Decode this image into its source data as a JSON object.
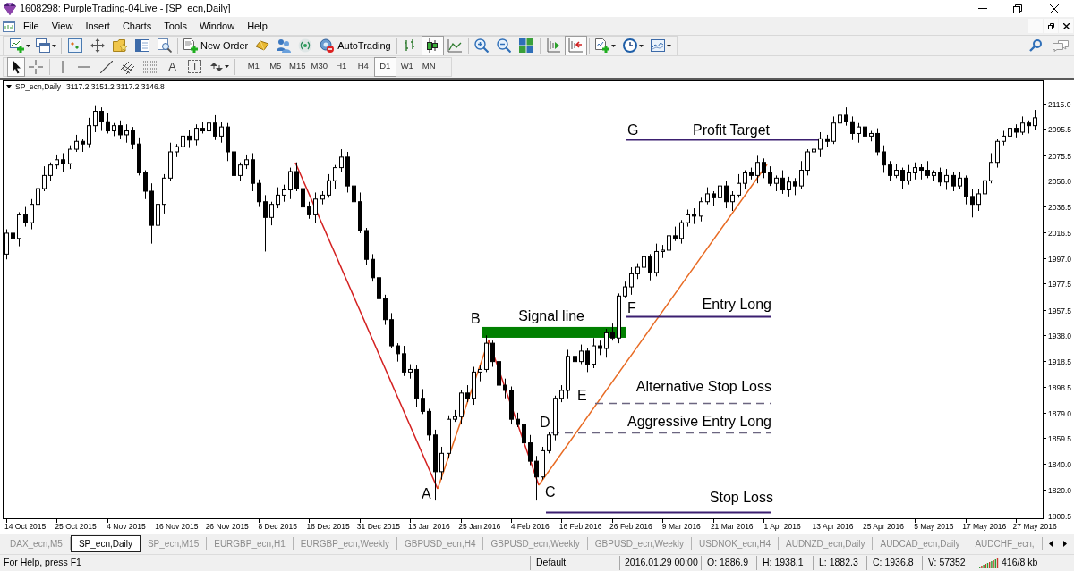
{
  "window": {
    "title": "1608298: PurpleTrading-04Live - [SP_ecn,Daily]"
  },
  "menu": [
    "File",
    "View",
    "Insert",
    "Charts",
    "Tools",
    "Window",
    "Help"
  ],
  "toolbar": {
    "new_order": "New Order",
    "auto_trading": "AutoTrading",
    "chart_types": [
      {
        "kind": "bar",
        "selected": false
      },
      {
        "kind": "candle",
        "selected": true
      },
      {
        "kind": "line",
        "selected": false
      }
    ],
    "toggles": [
      {
        "kind": "chart_shift",
        "on": false
      },
      {
        "kind": "autoscroll",
        "on": true
      }
    ]
  },
  "drawing_toolbar": {
    "tools": [
      {
        "kind": "cursor",
        "selected": true
      },
      {
        "kind": "crosshair",
        "selected": false
      },
      {
        "kind": "vertical_line",
        "selected": false
      },
      {
        "kind": "horizontal_line",
        "selected": false
      },
      {
        "kind": "trendline",
        "selected": false
      },
      {
        "kind": "channel",
        "selected": false
      },
      {
        "kind": "fibonacci",
        "selected": false
      },
      {
        "kind": "text",
        "label": "A",
        "selected": false
      },
      {
        "kind": "text_label",
        "label": "T",
        "selected": false
      },
      {
        "kind": "arrows",
        "selected": false
      }
    ],
    "timeframes": [
      {
        "label": "M1",
        "selected": false
      },
      {
        "label": "M5",
        "selected": false
      },
      {
        "label": "M15",
        "selected": false
      },
      {
        "label": "M30",
        "selected": false
      },
      {
        "label": "H1",
        "selected": false
      },
      {
        "label": "H4",
        "selected": false
      },
      {
        "label": "D1",
        "selected": true
      },
      {
        "label": "W1",
        "selected": false
      },
      {
        "label": "MN",
        "selected": false
      }
    ]
  },
  "chart": {
    "symbol": "SP_ecn,Daily",
    "quote": "3117.2 3151.2 3117.2 3146.8",
    "chart_data": {
      "type": "candlestick",
      "categories": [
        null,
        null,
        null,
        "14 Oct 2015",
        null,
        null,
        null,
        null,
        null,
        null,
        null,
        "25 Oct 2015",
        null,
        null,
        null,
        null,
        null,
        null,
        null,
        "4 Nov 2015",
        null,
        null,
        null,
        null,
        null,
        null,
        null,
        "16 Nov 2015",
        null,
        null,
        null,
        null,
        null,
        null,
        null,
        "26 Nov 2015",
        null,
        null,
        null,
        null,
        null,
        null,
        null,
        "8 Dec 2015",
        null,
        null,
        null,
        null,
        null,
        null,
        null,
        "18 Dec 2015",
        null,
        null,
        null,
        null,
        null,
        null,
        null,
        "31 Dec 2015",
        null,
        null,
        null,
        null,
        null,
        null,
        null,
        "13 Jan 2016",
        null,
        null,
        null,
        null,
        null,
        null,
        null,
        "25 Jan 2016",
        null,
        null,
        null,
        null,
        null,
        null,
        null,
        "4 Feb 2016",
        null,
        null,
        null,
        null,
        null,
        null,
        null,
        "16 Feb 2016",
        null,
        null,
        null,
        null,
        null,
        null,
        null,
        "26 Feb 2016",
        null,
        null,
        null,
        null,
        null,
        null,
        null,
        "9 Mar 2016",
        null,
        null,
        null,
        null,
        null,
        null,
        null,
        "21 Mar 2016",
        null,
        null,
        null,
        null,
        null,
        null,
        null,
        "1 Apr 2016",
        null,
        null,
        null,
        null,
        null,
        null,
        null,
        "13 Apr 2016",
        null,
        null,
        null,
        null,
        null,
        null,
        null,
        "25 Apr 2016",
        null,
        null,
        null,
        null,
        null,
        null,
        null,
        "5 May 2016",
        null,
        null,
        null,
        null,
        null,
        null,
        null,
        "17 May 2016",
        null,
        null,
        null,
        null,
        null,
        null,
        null,
        "27 May 2016"
      ],
      "ohlc": [
        [
          2000,
          2019,
          1996,
          2016
        ],
        [
          2016,
          2021,
          2010,
          2012
        ],
        [
          2012,
          2032,
          2006,
          2030
        ],
        [
          2030,
          2036,
          2021,
          2024
        ],
        [
          2024,
          2042,
          2019,
          2038
        ],
        [
          2038,
          2053,
          2031,
          2050
        ],
        [
          2050,
          2067,
          2048,
          2060
        ],
        [
          2060,
          2070,
          2056,
          2068
        ],
        [
          2068,
          2076,
          2065,
          2072
        ],
        [
          2072,
          2077,
          2063,
          2069
        ],
        [
          2069,
          2083,
          2065,
          2080
        ],
        [
          2080,
          2091,
          2078,
          2086
        ],
        [
          2086,
          2088,
          2078,
          2084
        ],
        [
          2084,
          2104,
          2081,
          2098
        ],
        [
          2098,
          2113,
          2093,
          2109
        ],
        [
          2109,
          2112,
          2094,
          2101
        ],
        [
          2101,
          2108,
          2092,
          2094
        ],
        [
          2094,
          2100,
          2090,
          2098
        ],
        [
          2098,
          2102,
          2088,
          2091
        ],
        [
          2091,
          2099,
          2085,
          2094
        ],
        [
          2094,
          2097,
          2080,
          2084
        ],
        [
          2084,
          2089,
          2060,
          2062
        ],
        [
          2062,
          2064,
          2042,
          2048
        ],
        [
          2048,
          2054,
          2008,
          2022
        ],
        [
          2022,
          2042,
          2017,
          2038
        ],
        [
          2038,
          2061,
          2031,
          2058
        ],
        [
          2058,
          2085,
          2056,
          2078
        ],
        [
          2078,
          2084,
          2074,
          2082
        ],
        [
          2082,
          2094,
          2079,
          2090
        ],
        [
          2090,
          2095,
          2081,
          2087
        ],
        [
          2087,
          2099,
          2083,
          2096
        ],
        [
          2096,
          2101,
          2092,
          2094
        ],
        [
          2094,
          2102,
          2088,
          2100
        ],
        [
          2100,
          2106,
          2087,
          2090
        ],
        [
          2090,
          2101,
          2085,
          2097
        ],
        [
          2097,
          2100,
          2071,
          2078
        ],
        [
          2078,
          2085,
          2058,
          2060
        ],
        [
          2060,
          2070,
          2056,
          2068
        ],
        [
          2068,
          2076,
          2065,
          2072
        ],
        [
          2072,
          2077,
          2048,
          2054
        ],
        [
          2054,
          2057,
          2036,
          2040
        ],
        [
          2040,
          2045,
          2002,
          2028
        ],
        [
          2028,
          2040,
          2022,
          2038
        ],
        [
          2038,
          2051,
          2035,
          2045
        ],
        [
          2045,
          2053,
          2040,
          2049
        ],
        [
          2049,
          2066,
          2042,
          2063
        ],
        [
          2063,
          2070,
          2048,
          2050
        ],
        [
          2050,
          2052,
          2032,
          2036
        ],
        [
          2036,
          2040,
          2027,
          2030
        ],
        [
          2030,
          2047,
          2024,
          2042
        ],
        [
          2042,
          2048,
          2038,
          2045
        ],
        [
          2045,
          2061,
          2043,
          2056
        ],
        [
          2056,
          2068,
          2050,
          2066
        ],
        [
          2066,
          2080,
          2063,
          2074
        ],
        [
          2074,
          2078,
          2047,
          2052
        ],
        [
          2052,
          2055,
          2033,
          2040
        ],
        [
          2040,
          2047,
          2016,
          2018
        ],
        [
          2018,
          2020,
          1992,
          1996
        ],
        [
          1996,
          2000,
          1979,
          1982
        ],
        [
          1982,
          1987,
          1960,
          1966
        ],
        [
          1966,
          1969,
          1946,
          1950
        ],
        [
          1950,
          1955,
          1928,
          1930
        ],
        [
          1930,
          1932,
          1918,
          1924
        ],
        [
          1924,
          1930,
          1907,
          1910
        ],
        [
          1910,
          1916,
          1905,
          1912
        ],
        [
          1912,
          1915,
          1883,
          1890
        ],
        [
          1890,
          1897,
          1878,
          1880
        ],
        [
          1880,
          1882,
          1858,
          1862
        ],
        [
          1862,
          1866,
          1812,
          1834
        ],
        [
          1834,
          1853,
          1828,
          1848
        ],
        [
          1848,
          1877,
          1844,
          1874
        ],
        [
          1874,
          1881,
          1872,
          1876
        ],
        [
          1876,
          1896,
          1870,
          1894
        ],
        [
          1894,
          1900,
          1887,
          1890
        ],
        [
          1890,
          1914,
          1885,
          1910
        ],
        [
          1910,
          1915,
          1903,
          1912
        ],
        [
          1912,
          1938,
          1910,
          1932
        ],
        [
          1932,
          1934,
          1914,
          1918
        ],
        [
          1918,
          1922,
          1897,
          1900
        ],
        [
          1900,
          1905,
          1890,
          1896
        ],
        [
          1896,
          1899,
          1870,
          1874
        ],
        [
          1874,
          1879,
          1868,
          1870
        ],
        [
          1870,
          1872,
          1850,
          1856
        ],
        [
          1856,
          1862,
          1839,
          1842
        ],
        [
          1842,
          1846,
          1812,
          1830
        ],
        [
          1830,
          1853,
          1828,
          1850
        ],
        [
          1850,
          1864,
          1848,
          1862
        ],
        [
          1862,
          1892,
          1858,
          1890
        ],
        [
          1890,
          1900,
          1887,
          1896
        ],
        [
          1896,
          1927,
          1890,
          1922
        ],
        [
          1922,
          1925,
          1914,
          1918
        ],
        [
          1918,
          1931,
          1916,
          1926
        ],
        [
          1926,
          1928,
          1910,
          1916
        ],
        [
          1916,
          1936,
          1913,
          1930
        ],
        [
          1930,
          1934,
          1923,
          1928
        ],
        [
          1928,
          1943,
          1921,
          1940
        ],
        [
          1940,
          1947,
          1934,
          1936
        ],
        [
          1936,
          1970,
          1932,
          1968
        ],
        [
          1968,
          1979,
          1967,
          1975
        ],
        [
          1975,
          1990,
          1969,
          1985
        ],
        [
          1985,
          1993,
          1981,
          1990
        ],
        [
          1990,
          2003,
          1988,
          1998
        ],
        [
          1998,
          2000,
          1980,
          1986
        ],
        [
          1986,
          2008,
          1983,
          2002
        ],
        [
          2002,
          2007,
          1997,
          2003
        ],
        [
          2003,
          2017,
          1996,
          2014
        ],
        [
          2014,
          2021,
          2010,
          2012
        ],
        [
          2012,
          2026,
          2008,
          2024
        ],
        [
          2024,
          2034,
          2021,
          2030
        ],
        [
          2030,
          2035,
          2023,
          2029
        ],
        [
          2029,
          2043,
          2025,
          2040
        ],
        [
          2040,
          2051,
          2038,
          2046
        ],
        [
          2046,
          2048,
          2037,
          2043
        ],
        [
          2043,
          2058,
          2040,
          2052
        ],
        [
          2052,
          2056,
          2035,
          2040
        ],
        [
          2040,
          2048,
          2033,
          2045
        ],
        [
          2045,
          2061,
          2043,
          2054
        ],
        [
          2054,
          2064,
          2050,
          2062
        ],
        [
          2062,
          2066,
          2057,
          2060
        ],
        [
          2060,
          2075,
          2054,
          2070
        ],
        [
          2070,
          2073,
          2058,
          2062
        ],
        [
          2062,
          2067,
          2052,
          2054
        ],
        [
          2054,
          2060,
          2048,
          2058
        ],
        [
          2058,
          2064,
          2046,
          2049
        ],
        [
          2049,
          2059,
          2044,
          2055
        ],
        [
          2055,
          2058,
          2045,
          2052
        ],
        [
          2052,
          2071,
          2050,
          2064
        ],
        [
          2064,
          2080,
          2060,
          2078
        ],
        [
          2078,
          2084,
          2075,
          2080
        ],
        [
          2080,
          2093,
          2074,
          2088
        ],
        [
          2088,
          2091,
          2082,
          2086
        ],
        [
          2086,
          2105,
          2084,
          2100
        ],
        [
          2100,
          2108,
          2094,
          2106
        ],
        [
          2106,
          2112,
          2098,
          2101
        ],
        [
          2101,
          2105,
          2087,
          2092
        ],
        [
          2092,
          2100,
          2085,
          2097
        ],
        [
          2097,
          2104,
          2088,
          2090
        ],
        [
          2090,
          2094,
          2086,
          2092
        ],
        [
          2092,
          2096,
          2075,
          2078
        ],
        [
          2078,
          2083,
          2062,
          2068
        ],
        [
          2068,
          2071,
          2056,
          2060
        ],
        [
          2060,
          2069,
          2058,
          2064
        ],
        [
          2064,
          2066,
          2050,
          2056
        ],
        [
          2056,
          2068,
          2053,
          2062
        ],
        [
          2062,
          2070,
          2057,
          2066
        ],
        [
          2066,
          2069,
          2057,
          2064
        ],
        [
          2064,
          2071,
          2058,
          2060
        ],
        [
          2060,
          2064,
          2056,
          2062
        ],
        [
          2062,
          2066,
          2052,
          2055
        ],
        [
          2055,
          2065,
          2049,
          2060
        ],
        [
          2060,
          2063,
          2048,
          2052
        ],
        [
          2052,
          2063,
          2050,
          2058
        ],
        [
          2058,
          2060,
          2038,
          2044
        ],
        [
          2044,
          2050,
          2028,
          2038
        ],
        [
          2038,
          2050,
          2033,
          2046
        ],
        [
          2046,
          2059,
          2039,
          2056
        ],
        [
          2056,
          2077,
          2054,
          2070
        ],
        [
          2070,
          2088,
          2066,
          2086
        ],
        [
          2086,
          2094,
          2083,
          2090
        ],
        [
          2090,
          2101,
          2084,
          2096
        ],
        [
          2096,
          2099,
          2089,
          2093
        ],
        [
          2093,
          2105,
          2091,
          2100
        ],
        [
          2100,
          2102,
          2092,
          2098
        ],
        [
          2098,
          2110,
          2095,
          2104
        ]
      ],
      "ylim": [
        1798.1,
        2132.2
      ],
      "yticks": [
        {
          "value": 2115,
          "label": "2115.0"
        },
        {
          "value": 2095.5,
          "label": "2095.5"
        },
        {
          "value": 2075.5,
          "label": "2075.5"
        },
        {
          "value": 2056,
          "label": "2056.0"
        },
        {
          "value": 2036.5,
          "label": "2036.5"
        },
        {
          "value": 2016.5,
          "label": "2016.5"
        },
        {
          "value": 1997,
          "label": "1997.0"
        },
        {
          "value": 1977.5,
          "label": "1977.5"
        },
        {
          "value": 1957.5,
          "label": "1957.5"
        },
        {
          "value": 1938,
          "label": "1938.0"
        },
        {
          "value": 1918.5,
          "label": "1918.5"
        },
        {
          "value": 1898.5,
          "label": "1898.5"
        },
        {
          "value": 1879,
          "label": "1879.0"
        },
        {
          "value": 1859.5,
          "label": "1859.5"
        },
        {
          "value": 1840,
          "label": "1840.0"
        },
        {
          "value": 1820,
          "label": "1820.0"
        },
        {
          "value": 1800.5,
          "label": "1800.5"
        }
      ],
      "bands": [
        {
          "axis": "y",
          "from": 1936.2,
          "to": 1944.4
        }
      ]
    },
    "markers": [
      "A",
      "B",
      "C",
      "D",
      "E",
      "F",
      "G"
    ],
    "levels": [
      {
        "kind": "solid",
        "label": "Profit Target"
      },
      {
        "kind": "band",
        "label": "Signal line"
      },
      {
        "kind": "solid",
        "label": "Entry Long"
      },
      {
        "kind": "dashed",
        "label": "Alternative Stop Loss"
      },
      {
        "kind": "dashed",
        "label": "Aggressive Entry Long"
      },
      {
        "kind": "solid",
        "label": "Stop Loss"
      }
    ]
  },
  "tabs": [
    {
      "label": "DAX_ecn,M5",
      "selected": false
    },
    {
      "label": "SP_ecn,Daily",
      "selected": true
    },
    {
      "label": "SP_ecn,M15",
      "selected": false
    },
    {
      "label": "EURGBP_ecn,H1",
      "selected": false
    },
    {
      "label": "EURGBP_ecn,Weekly",
      "selected": false
    },
    {
      "label": "GBPUSD_ecn,H4",
      "selected": false
    },
    {
      "label": "GBPUSD_ecn,Weekly",
      "selected": false
    },
    {
      "label": "GBPUSD_ecn,Weekly",
      "selected": false
    },
    {
      "label": "USDNOK_ecn,H4",
      "selected": false
    },
    {
      "label": "AUDNZD_ecn,Daily",
      "selected": false
    },
    {
      "label": "AUDCAD_ecn,Daily",
      "selected": false
    },
    {
      "label": "AUDCHF_ecn,",
      "selected": false
    }
  ],
  "status_bar": {
    "help": "For Help, press F1",
    "profile": "Default",
    "time": "2016.01.29 00:00",
    "open": "O: 1886.9",
    "high": "H: 1938.1",
    "low": "L: 1882.3",
    "close": "C: 1936.8",
    "volume": "V: 57352",
    "traffic": "416/8 kb"
  }
}
